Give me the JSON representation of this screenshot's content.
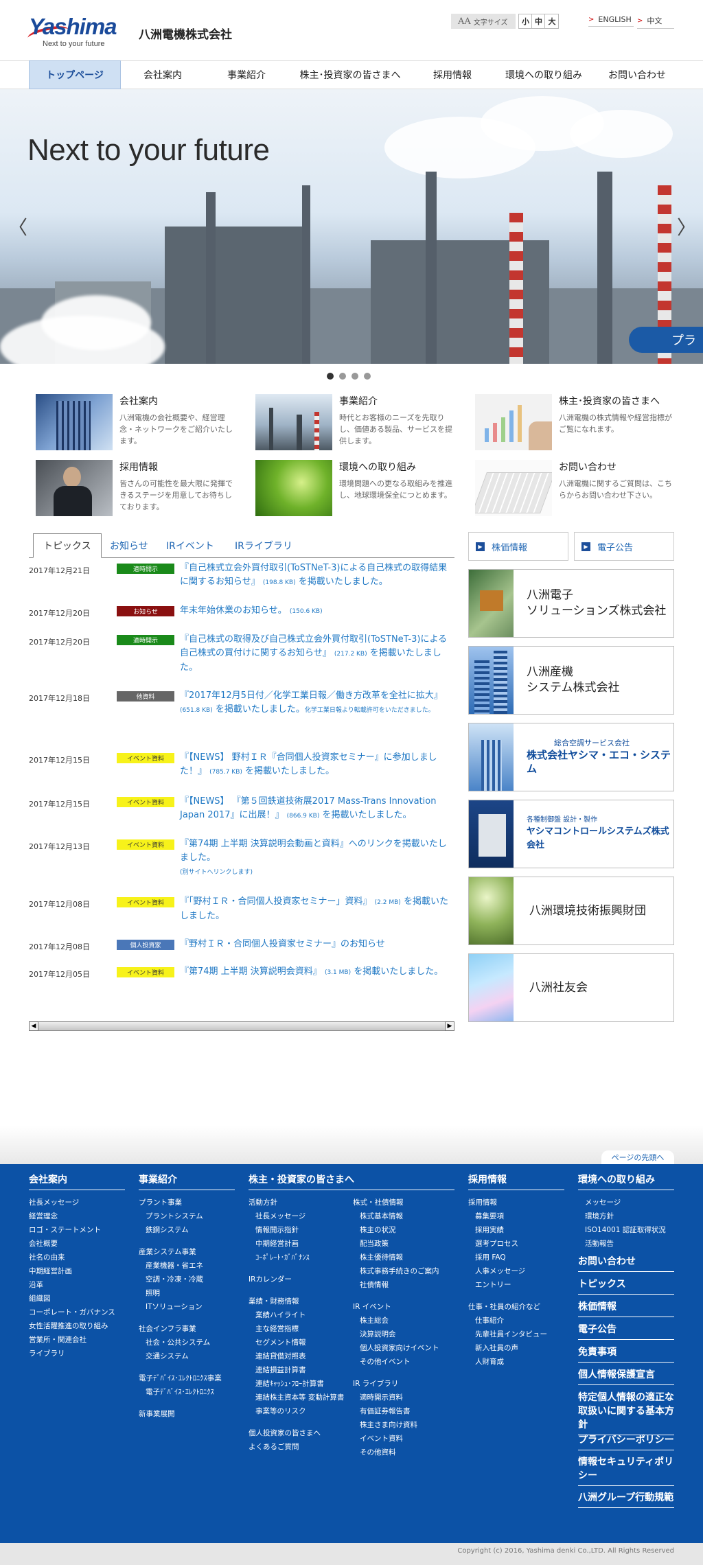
{
  "header": {
    "logo_word": "Yashima",
    "logo_tag": "Next to your future",
    "company": "八洲電機株式会社",
    "fontsize_label": "文字サイズ",
    "fontsize_aa": "AA",
    "sizes": [
      "小",
      "中",
      "大"
    ],
    "lang_en": "ENGLISH",
    "lang_cn": "中文"
  },
  "nav": [
    "トップページ",
    "会社案内",
    "事業紹介",
    "株主･投資家の皆さまへ",
    "採用情報",
    "環境への取り組み",
    "お問い合わせ"
  ],
  "hero": {
    "title": "Next to your future",
    "badge": "プラ",
    "prev": "〈",
    "next": "〉"
  },
  "cards": [
    {
      "title": "会社案内",
      "desc": "八洲電機の会社概要や、経営理念・ネットワークをご紹介いたします。"
    },
    {
      "title": "事業紹介",
      "desc": "時代とお客様のニーズを先取りし、価値ある製品、サービスを提供します。"
    },
    {
      "title": "株主･投資家の皆さまへ",
      "desc": "八洲電機の株式情報や経営指標がご覧になれます。"
    },
    {
      "title": "採用情報",
      "desc": "皆さんの可能性を最大限に発揮できるステージを用意してお待ちしております。"
    },
    {
      "title": "環境への取り組み",
      "desc": "環境問題への更なる取組みを推進し、地球環境保全につとめます。"
    },
    {
      "title": "お問い合わせ",
      "desc": "八洲電機に関するご質問は、こちらからお問い合わせ下さい。"
    }
  ],
  "tabs": [
    "トピックス",
    "お知らせ",
    "IRイベント",
    "IRライブラリ"
  ],
  "news": [
    {
      "date": "2017年12月21日",
      "tag": "適時開示",
      "text": "『自己株式立会外買付取引(ToSTNeT-3)による自己株式の取得結果に関するお知らせ』",
      "size": "(198.8 KB)",
      "tail": "を掲載いたしました。",
      "note": ""
    },
    {
      "date": "2017年12月20日",
      "tag": "お知らせ",
      "text": "年末年始休業のお知らせ。",
      "size": "(150.6 KB)",
      "tail": "",
      "note": ""
    },
    {
      "date": "2017年12月20日",
      "tag": "適時開示",
      "text": "『自己株式の取得及び自己株式立会外買付取引(ToSTNeT-3)による自己株式の買付けに関するお知らせ』",
      "size": "(217.2 KB)",
      "tail": "を掲載いたしました。",
      "note": ""
    },
    {
      "date": "2017年12月18日",
      "tag": "他資料",
      "text": "『2017年12月5日付／化学工業日報／働き方改革を全社に拡大』",
      "size": "(651.8 KB)",
      "tail": "を掲載いたしました。",
      "note": "化学工業日報より転載許可をいただきました。"
    },
    {
      "date": "2017年12月15日",
      "tag": "イベント資料",
      "text": "『【NEWS】 野村ＩＲ『合同個人投資家セミナー』に参加しました！』",
      "size": "(785.7 KB)",
      "tail": "を掲載いたしました。",
      "note": ""
    },
    {
      "date": "2017年12月15日",
      "tag": "イベント資料",
      "text": "『【NEWS】 『第５回鉄道技術展2017 Mass-Trans Innovation Japan 2017』に出展！』",
      "size": "(866.9 KB)",
      "tail": "を掲載いたしました。",
      "note": ""
    },
    {
      "date": "2017年12月13日",
      "tag": "イベント資料",
      "text": "『第74期 上半期 決算説明会動画と資料』へのリンクを掲載いたしました。",
      "size": "",
      "tail": "",
      "note": "(別サイトへリンクします)"
    },
    {
      "date": "2017年12月08日",
      "tag": "イベント資料",
      "text": "『「野村ＩＲ・合同個人投資家セミナー」資料』",
      "size": "(2.2 MB)",
      "tail": "を掲載いたしました。",
      "note": ""
    },
    {
      "date": "2017年12月08日",
      "tag": "個人投資家",
      "text": "『野村ＩＲ・合同個人投資家セミナー』のお知らせ",
      "size": "",
      "tail": "",
      "note": ""
    },
    {
      "date": "2017年12月05日",
      "tag": "イベント資料",
      "text": "『第74期 上半期 決算説明会資料』",
      "size": "(3.1 MB)",
      "tail": "を掲載いたしました。",
      "note": ""
    }
  ],
  "scroll": {
    "left": "◀",
    "right": "▶"
  },
  "side_buttons": [
    "株価情報",
    "電子公告"
  ],
  "banners": [
    {
      "line1": "八洲電子",
      "line2": "ソリューションズ株式会社"
    },
    {
      "line1": "八洲産機",
      "line2": "システム株式会社"
    },
    {
      "line1": "総合空調サービス会社",
      "line2": "株式会社ヤシマ・エコ・システム"
    },
    {
      "line1": "各種制御盤 設計・製作",
      "line2": "ヤシマコントロールシステムズ株式会社"
    },
    {
      "line1": "八洲環境技術振興財団",
      "line2": ""
    },
    {
      "line1": "八洲社友会",
      "line2": ""
    }
  ],
  "pagetop": "ページの先頭へ",
  "footer": {
    "col1": {
      "head": "会社案内",
      "items": [
        "社長メッセージ",
        "経営理念",
        "ロゴ・ステートメント",
        "会社概要",
        "社名の由来",
        "中期経営計画",
        "沿革",
        "組織図",
        "コーポレート・ガバナンス",
        "女性活躍推進の取り組み",
        "営業所・関連会社",
        "ライブラリ"
      ]
    },
    "col2": {
      "head": "事業紹介",
      "items": [
        "プラント事業",
        " プラントシステム",
        " 鉄鋼システム",
        "",
        "産業システム事業",
        " 産業機器・省エネ",
        " 空調・冷凍・冷蔵",
        " 照明",
        " ITソリューション",
        "",
        "社会インフラ事業",
        " 社会・公共システム",
        " 交通システム",
        "",
        "電子ﾃﾞﾊﾞｲｽ･ｴﾚｸﾄﾛﾆｸｽ事業",
        " 電子ﾃﾞﾊﾞｲｽ･ｴﾚｸﾄﾛﾆｸｽ",
        "",
        "新事業展開"
      ]
    },
    "col3": {
      "head": "株主・投資家の皆さまへ",
      "items": [
        "活動方針",
        " 社長メッセージ",
        " 情報開示指針",
        " 中期経営計画",
        " ｺｰﾎﾟﾚｰﾄ･ｶﾞﾊﾞﾅﾝｽ",
        "",
        "IRカレンダー",
        "",
        "業績・財務情報",
        " 業績ハイライト",
        " 主な経営指標",
        " セグメント情報",
        " 連結貸借対照表",
        " 連結損益計算書",
        " 連結ｷｬｯｼｭ･ﾌﾛｰ計算書",
        " 連結株主資本等 変動計算書",
        " 事業等のリスク",
        "",
        "個人投資家の皆さまへ",
        "よくあるご質問"
      ]
    },
    "col4": {
      "items": [
        "株式・社債情報",
        " 株式基本情報",
        " 株主の状況",
        " 配当政策",
        " 株主優待情報",
        " 株式事務手続きのご案内",
        " 社債情報",
        "",
        "IR イベント",
        " 株主総会",
        " 決算説明会",
        " 個人投資家向けイベント",
        " その他イベント",
        "",
        "IR ライブラリ",
        " 適時開示資料",
        " 有価証券報告書",
        " 株主さま向け資料",
        " イベント資料",
        " その他資料"
      ]
    },
    "col5": {
      "head": "採用情報",
      "items": [
        "採用情報",
        " 募集要項",
        " 採用実績",
        " 選考プロセス",
        " 採用 FAQ",
        " 人事メッセージ",
        " エントリー",
        "",
        "仕事・社員の紹介など",
        " 仕事紹介",
        " 先輩社員インタビュー",
        " 新入社員の声",
        " 人財育成"
      ]
    },
    "col6": {
      "head": "環境への取り組み",
      "items": [
        " メッセージ",
        " 環境方針",
        " ISO14001 認証取得状況",
        " 活動報告"
      ]
    },
    "bold_links": [
      "お問い合わせ",
      "トピックス",
      "株価情報",
      "電子公告",
      "免責事項",
      "個人情報保護宣言",
      "特定個人情報の適正な取扱いに関する基本方針",
      "プライバシーポリシー",
      "情報セキュリティポリシー",
      "八洲グループ行動規範"
    ],
    "copyright": "Copyright (c) 2016, Yashima denki Co.,LTD. All Rights Reserved"
  },
  "colors": {
    "brand": "#1c4e9a",
    "footer": "#0c52a6",
    "link": "#1f78c4"
  }
}
